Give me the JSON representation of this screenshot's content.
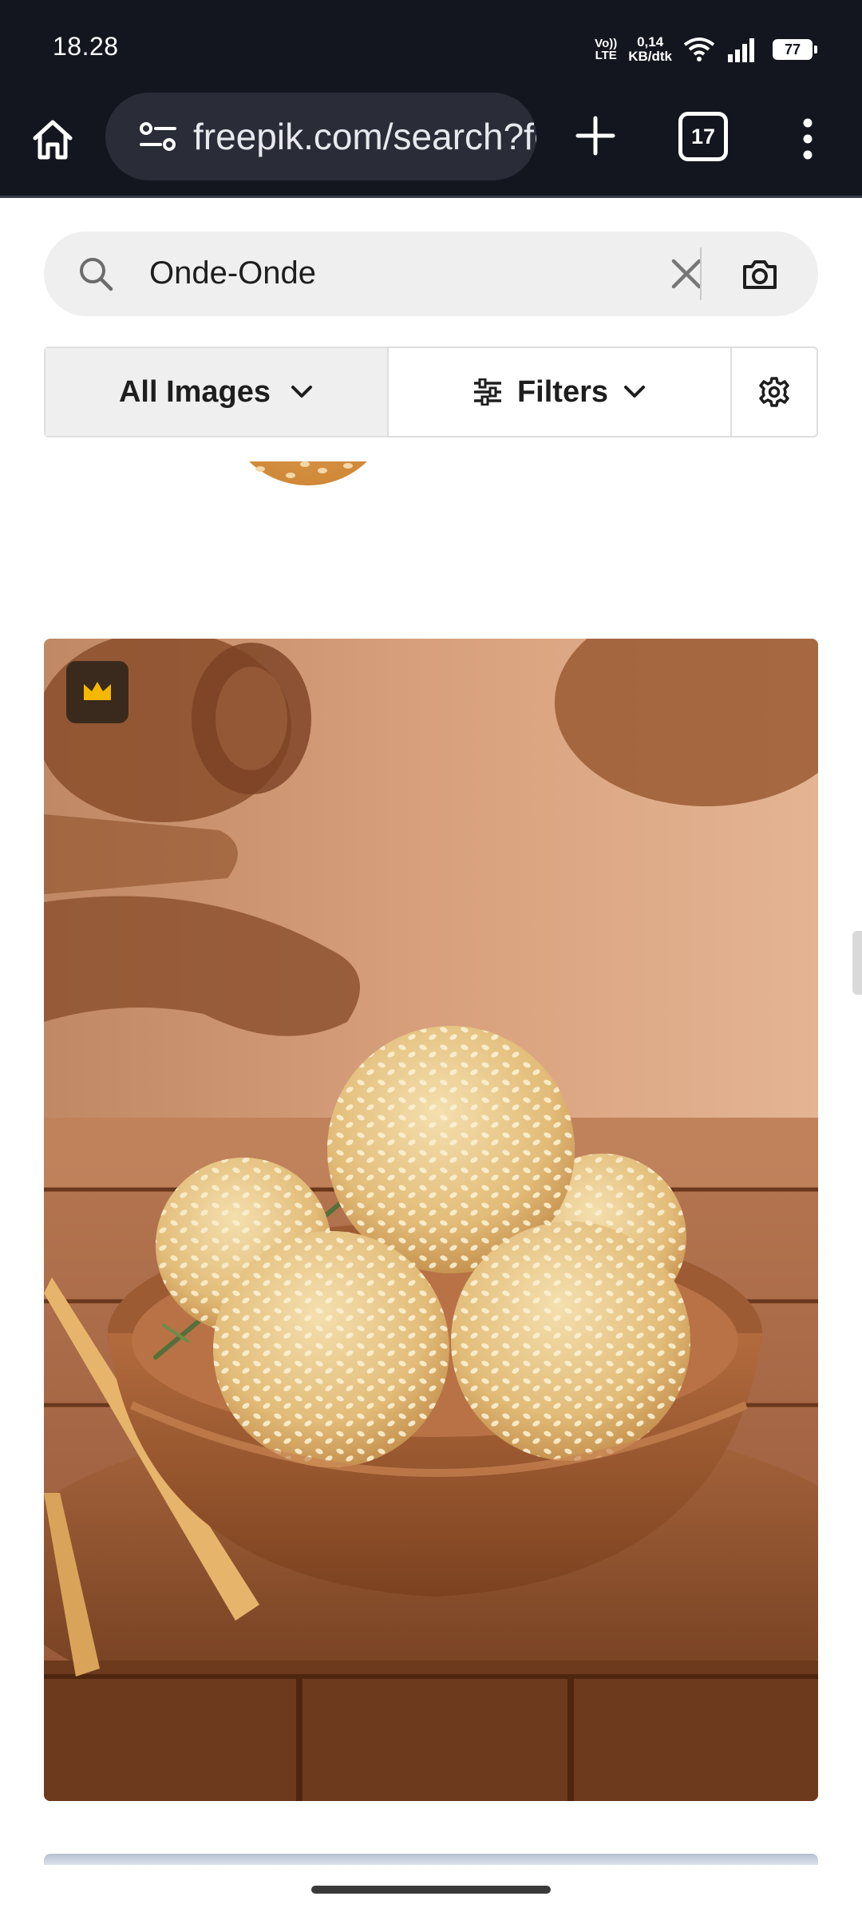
{
  "status_bar": {
    "time": "18.28",
    "volte_top": "Vo))",
    "volte_bottom": "LTE",
    "net_speed_value": "0,14",
    "net_speed_unit": "KB/dtk",
    "battery": "77"
  },
  "browser": {
    "url": "freepik.com/search?fc",
    "tab_count": "17"
  },
  "search": {
    "query": "Onde-Onde"
  },
  "filters": {
    "content_type": "All Images",
    "filters_label": "Filters"
  },
  "results": {
    "items": [
      {
        "type": "image",
        "premium": true,
        "subject": "sesame balls in wooden bowl"
      }
    ]
  },
  "colors": {
    "browser_chrome": "#14161f",
    "url_pill": "#2a2d38",
    "premium_crown": "#f5b800",
    "premium_badge_bg": "#3a2a1d"
  },
  "icons": [
    "home-icon",
    "site-info-icon",
    "plus-icon",
    "tabs-icon",
    "more-vert-icon",
    "search-icon",
    "close-icon",
    "camera-icon",
    "chevron-down-icon",
    "sliders-icon",
    "gear-icon",
    "crown-icon",
    "wifi-icon",
    "signal-icon",
    "battery-icon"
  ]
}
